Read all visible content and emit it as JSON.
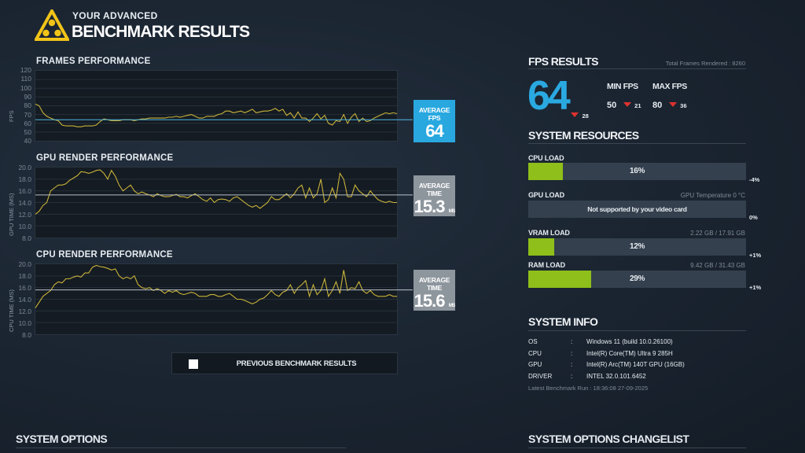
{
  "header": {
    "subtitle": "YOUR ADVANCED",
    "title": "BENCHMARK RESULTS"
  },
  "colors": {
    "accent": "#29a8e0",
    "line": "#c9b23a",
    "bar": "#8fbf1a",
    "down": "#e0322d",
    "avg_line": "#4fb7e6"
  },
  "charts": [
    {
      "title": "FRAMES PERFORMANCE",
      "ylabel": "FPS",
      "yticks": [
        "120",
        "110",
        "100",
        "90",
        "80",
        "70",
        "60",
        "50",
        "40"
      ],
      "ylim": [
        40,
        120
      ],
      "avg_value": 64,
      "avg_box": {
        "label": "AVERAGE FPS",
        "value": "64",
        "unit": ""
      },
      "series": [
        82,
        80,
        72,
        68,
        66,
        64,
        63,
        58,
        57,
        57,
        57,
        56,
        56,
        57,
        57,
        57,
        58,
        62,
        65,
        64,
        63,
        63,
        63,
        64,
        64,
        64,
        63,
        64,
        65,
        65,
        66,
        66,
        66,
        66,
        66,
        67,
        67,
        68,
        67,
        68,
        69,
        70,
        68,
        66,
        66,
        68,
        68,
        68,
        70,
        71,
        74,
        74,
        72,
        73,
        74,
        72,
        74,
        76,
        72,
        73,
        74,
        74,
        75,
        77,
        74,
        76,
        69,
        72,
        66,
        73,
        66,
        66,
        62,
        66,
        71,
        65,
        69,
        60,
        58,
        63,
        62,
        70,
        60,
        67,
        71,
        62,
        66,
        62,
        63,
        66,
        68,
        70,
        72,
        71,
        72,
        71
      ]
    },
    {
      "title": "GPU RENDER PERFORMANCE",
      "ylabel": "GPU TIME (MS)",
      "yticks": [
        "20.0",
        "18.0",
        "16.0",
        "14.0",
        "12.0",
        "10.0",
        "8.0"
      ],
      "ylim": [
        8,
        20
      ],
      "avg_value": 15.3,
      "avg_box": {
        "label": "AVERAGE TIME",
        "value": "15.3",
        "unit": "MS"
      },
      "series": [
        12.0,
        12.5,
        13.5,
        14.0,
        16.0,
        16.5,
        17.0,
        17.0,
        17.2,
        17.8,
        18.2,
        18.6,
        19.3,
        19.2,
        19.0,
        19.2,
        19.5,
        19.6,
        19.0,
        18.0,
        19.5,
        18.5,
        17.0,
        16.0,
        16.5,
        17.0,
        16.0,
        15.5,
        15.8,
        15.5,
        15.3,
        15.0,
        15.5,
        15.2,
        15.0,
        15.0,
        15.2,
        15.4,
        15.0,
        15.0,
        14.8,
        15.2,
        15.5,
        15.0,
        14.5,
        14.2,
        14.8,
        14.0,
        14.5,
        14.6,
        14.5,
        14.2,
        14.8,
        15.0,
        14.5,
        14.0,
        13.5,
        13.2,
        13.5,
        13.0,
        13.5,
        14.0,
        15.0,
        14.5,
        14.5,
        15.0,
        15.5,
        14.8,
        15.5,
        16.5,
        17.0,
        14.8,
        16.5,
        14.8,
        15.5,
        18.0,
        14.0,
        14.5,
        16.5,
        14.8,
        19.0,
        18.0,
        15.0,
        15.0,
        17.0,
        16.0,
        15.5,
        15.0,
        16.0,
        15.2,
        14.5,
        14.2,
        14.0,
        14.2,
        14.0,
        14.0
      ]
    },
    {
      "title": "CPU RENDER PERFORMANCE",
      "ylabel": "CPU TIME (MS)",
      "yticks": [
        "20.0",
        "18.0",
        "16.0",
        "14.0",
        "12.0",
        "10.0",
        "8.0"
      ],
      "ylim": [
        8,
        20
      ],
      "avg_value": 15.6,
      "avg_box": {
        "label": "AVERAGE TIME",
        "value": "15.6",
        "unit": "MS"
      },
      "series": [
        12.5,
        13.5,
        14.5,
        15.0,
        15.5,
        16.5,
        17.0,
        16.8,
        17.5,
        17.5,
        17.8,
        18.0,
        17.8,
        18.5,
        18.5,
        19.5,
        19.8,
        19.6,
        19.5,
        19.3,
        19.0,
        19.2,
        18.0,
        17.5,
        17.8,
        17.5,
        18.0,
        16.5,
        16.0,
        15.8,
        16.0,
        15.5,
        15.8,
        15.5,
        15.0,
        15.5,
        15.2,
        15.5,
        15.0,
        14.8,
        15.0,
        15.2,
        15.0,
        14.5,
        14.5,
        14.5,
        14.8,
        14.8,
        14.5,
        14.5,
        14.8,
        15.0,
        14.5,
        14.0,
        14.0,
        13.8,
        13.5,
        13.2,
        13.5,
        14.0,
        14.2,
        14.8,
        15.5,
        14.8,
        14.5,
        15.2,
        15.5,
        16.5,
        15.0,
        16.0,
        16.5,
        17.2,
        14.5,
        16.5,
        14.8,
        15.5,
        17.5,
        14.5,
        15.5,
        17.0,
        15.0,
        19.0,
        15.5,
        16.0,
        15.8,
        17.0,
        15.5,
        15.0,
        15.5,
        14.8,
        14.5,
        14.5,
        14.5,
        14.8,
        14.5,
        14.5
      ]
    }
  ],
  "previous_button": {
    "label": "PREVIOUS BENCHMARK RESULTS"
  },
  "fps_results": {
    "title": "FPS RESULTS",
    "total_frames": "Total Frames Rendered : 8260",
    "avg": "64",
    "avg_delta": "28",
    "min_label": "MIN FPS",
    "min_value": "50",
    "min_delta": "21",
    "max_label": "MAX FPS",
    "max_value": "80",
    "max_delta": "36"
  },
  "system_resources": {
    "title": "SYSTEM RESOURCES",
    "items": [
      {
        "label": "CPU LOAD",
        "info": "",
        "text": "16%",
        "fill": 0.16,
        "delta": "-4%"
      },
      {
        "label": "GPU LOAD",
        "info": "GPU Temperature 0 °C",
        "text": "Not supported by your video card",
        "fill": 0,
        "delta": "0%"
      },
      {
        "label": "VRAM LOAD",
        "info": "2.22 GB / 17.91 GB",
        "text": "12%",
        "fill": 0.12,
        "delta": "+1%"
      },
      {
        "label": "RAM LOAD",
        "info": "9.42 GB / 31.43 GB",
        "text": "29%",
        "fill": 0.29,
        "delta": "+1%"
      }
    ]
  },
  "system_info": {
    "title": "SYSTEM INFO",
    "rows": [
      {
        "key": "OS",
        "value": "Windows 11 (build 10.0.26100)"
      },
      {
        "key": "CPU",
        "value": "Intel(R) Core(TM) Ultra 9 285H"
      },
      {
        "key": "GPU",
        "value": "Intel(R) Arc(TM) 140T GPU (16GB)"
      },
      {
        "key": "DRIVER",
        "value": "INTEL 32.0.101.6452"
      }
    ],
    "colon": ":",
    "latest_run": "Latest Benchmark Run : 18:36:08 27-09-2025"
  },
  "bottom": {
    "left_title": "SYSTEM OPTIONS",
    "right_title": "SYSTEM OPTIONS CHANGELIST"
  }
}
